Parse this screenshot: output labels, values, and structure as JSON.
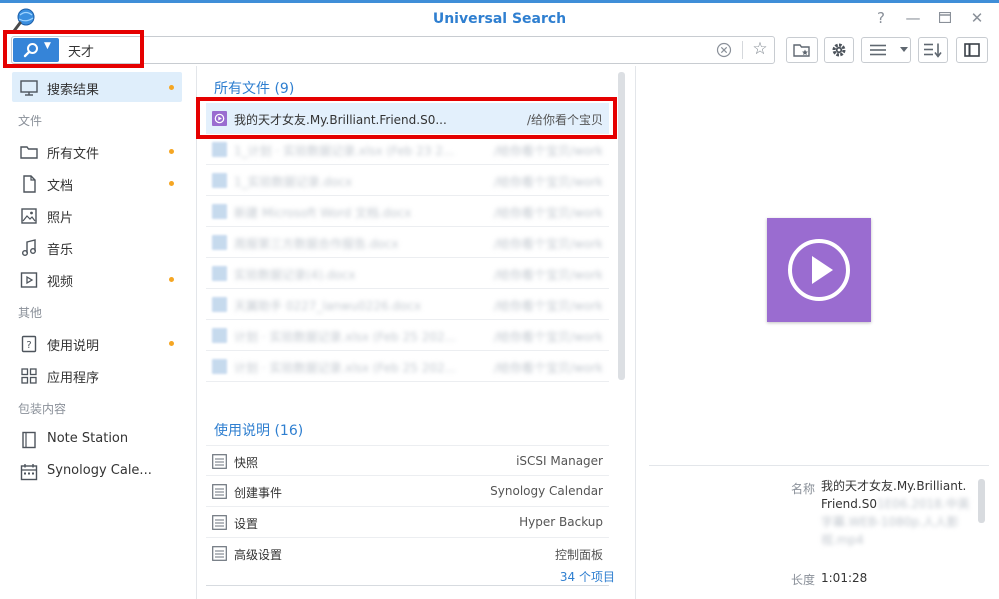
{
  "window": {
    "title": "Universal Search"
  },
  "search": {
    "query": "天才"
  },
  "sidebar": {
    "active": {
      "label": "搜索结果"
    },
    "sections": [
      {
        "heading": "文件",
        "items": [
          {
            "label": "所有文件",
            "dot": true
          },
          {
            "label": "文档",
            "dot": true
          },
          {
            "label": "照片",
            "dot": false
          },
          {
            "label": "音乐",
            "dot": false
          },
          {
            "label": "视频",
            "dot": true
          }
        ]
      },
      {
        "heading": "其他",
        "items": [
          {
            "label": "使用说明",
            "dot": true
          },
          {
            "label": "应用程序",
            "dot": false
          }
        ]
      },
      {
        "heading": "包装内容",
        "items": [
          {
            "label": "Note Station",
            "dot": false
          },
          {
            "label": "Synology Cale...",
            "dot": false
          }
        ]
      }
    ]
  },
  "results": {
    "files": {
      "title": "所有文件 (9)",
      "rows": [
        {
          "name": "我的天才女友.My.Brilliant.Friend.S0...",
          "path": "/给你看个宝贝"
        },
        {
          "name": "1_计划 · 实验数据记录.xlsx (Feb 23 2...",
          "path": "/给你看个宝贝/work"
        },
        {
          "name": "1_实验数据记录.docx",
          "path": "/给你看个宝贝/work"
        },
        {
          "name": "新建 Microsoft Word 文档.docx",
          "path": "/给你看个宝贝/work"
        },
        {
          "name": "周报第三方数据合作报告.docx",
          "path": "/给你看个宝贝/work"
        },
        {
          "name": "实验数据记录(4).docx",
          "path": "/给你看个宝贝/work"
        },
        {
          "name": "天翼助手 0227_lanwu0226.docx",
          "path": "/给你看个宝贝/work"
        },
        {
          "name": "计划 · 实验数据记录.xlsx (Feb 25 202...",
          "path": "/给你看个宝贝/work"
        },
        {
          "name": "计划 · 实验数据记录.xlsx (Feb 25 202...",
          "path": "/给你看个宝贝/work"
        }
      ]
    },
    "help": {
      "title": "使用说明 (16)",
      "rows": [
        {
          "name": "快照",
          "path": "iSCSI Manager"
        },
        {
          "name": "创建事件",
          "path": "Synology Calendar"
        },
        {
          "name": "设置",
          "path": "Hyper Backup"
        },
        {
          "name": "高级设置",
          "path": "控制面板"
        }
      ],
      "more": "34 个项目"
    }
  },
  "preview": {
    "meta": [
      {
        "label": "名称",
        "value": "我的天才女友.My.Brilliant.Friend.S0",
        "hidden": "1E06.2018.中英字幕.WEB-1080p.人人影视.mp4"
      },
      {
        "label": "长度",
        "value": "1:01:28"
      }
    ]
  },
  "colors": {
    "accent": "#3584d8",
    "title": "#2f7fd0",
    "highlight": "#e50000",
    "video": "#9a6cd0",
    "dot": "#f5a623"
  }
}
